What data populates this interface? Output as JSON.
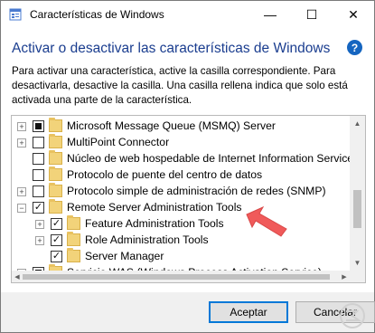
{
  "window": {
    "title": "Características de Windows",
    "controls": {
      "minimize": "—",
      "maximize": "☐",
      "close": "✕"
    }
  },
  "heading": "Activar o desactivar las características de Windows",
  "help": "?",
  "description": "Para activar una característica, active la casilla correspondiente. Para desactivarla, desactive la casilla. Una casilla rellena indica que solo está activada una parte de la característica.",
  "features": [
    {
      "label": "Microsoft Message Queue (MSMQ) Server",
      "state": "partial",
      "expander": "+",
      "level": 0
    },
    {
      "label": "MultiPoint Connector",
      "state": "unchecked",
      "expander": "+",
      "level": 0
    },
    {
      "label": "Núcleo de web hospedable de Internet Information Services",
      "state": "unchecked",
      "expander": "",
      "level": 0
    },
    {
      "label": "Protocolo de puente del centro de datos",
      "state": "unchecked",
      "expander": "",
      "level": 0
    },
    {
      "label": "Protocolo simple de administración de redes (SNMP)",
      "state": "unchecked",
      "expander": "+",
      "level": 0
    },
    {
      "label": "Remote Server Administration Tools",
      "state": "checked",
      "expander": "−",
      "level": 0
    },
    {
      "label": "Feature Administration Tools",
      "state": "checked",
      "expander": "+",
      "level": 1
    },
    {
      "label": "Role Administration Tools",
      "state": "checked",
      "expander": "+",
      "level": 1
    },
    {
      "label": "Server Manager",
      "state": "checked",
      "expander": "",
      "level": 1
    },
    {
      "label": "Servicio WAS (Windows Process Activation Service)",
      "state": "partial",
      "expander": "+",
      "level": 0
    }
  ],
  "buttons": {
    "accept": "Aceptar",
    "cancel": "Cancelar"
  },
  "colors": {
    "heading": "#1a3d8f",
    "arrow": "#f05a5a",
    "folder": "#f2d37a",
    "accent": "#0078d7"
  }
}
